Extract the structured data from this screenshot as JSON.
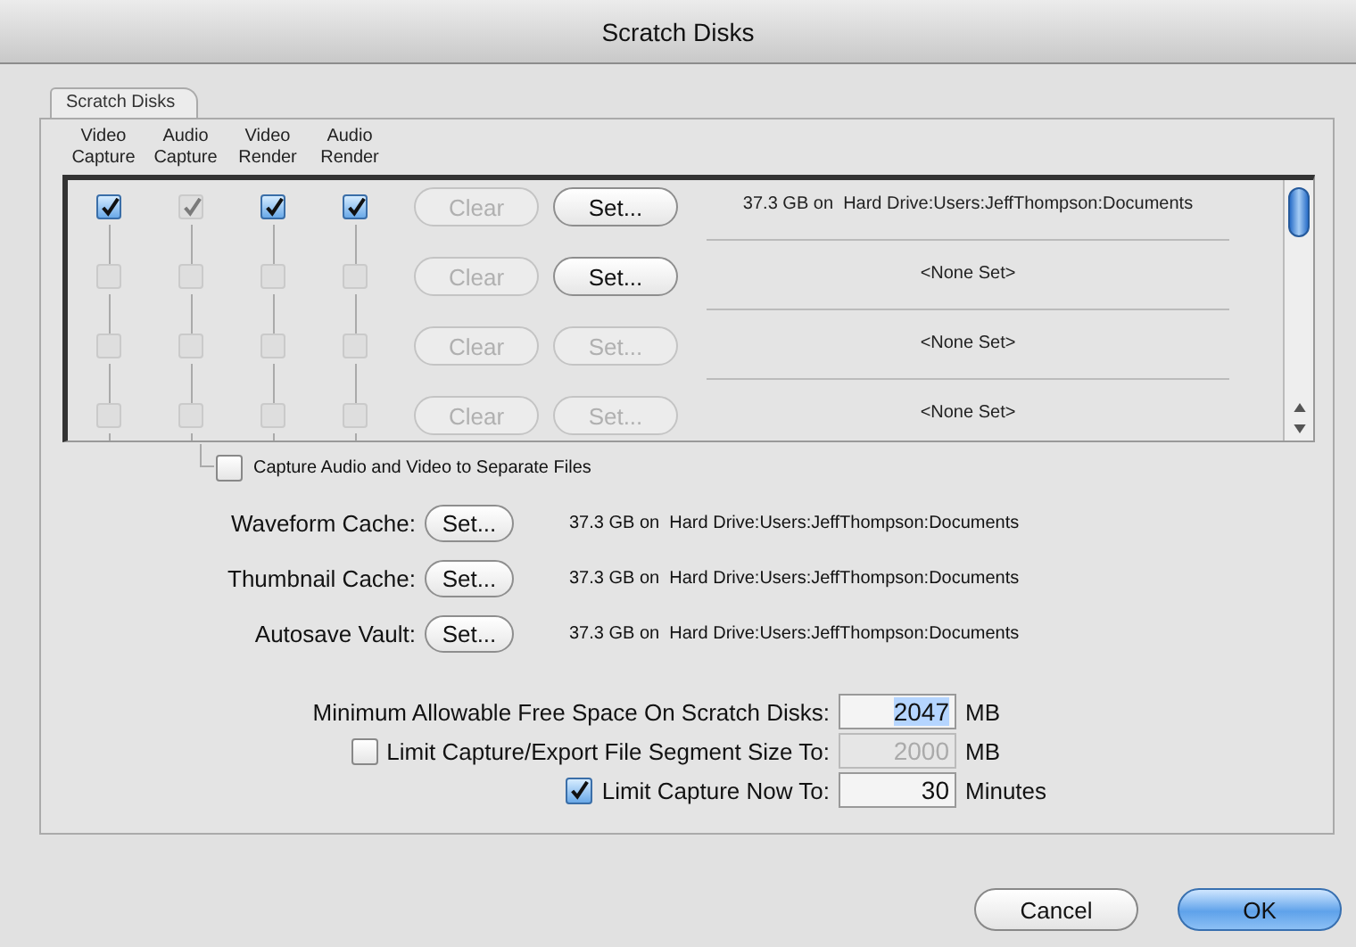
{
  "window": {
    "title": "Scratch Disks"
  },
  "tabs": [
    {
      "label": "Scratch Disks",
      "selected": true
    }
  ],
  "columns": [
    "Video Capture",
    "Audio Capture",
    "Video Render",
    "Audio Render"
  ],
  "disks": [
    {
      "checks": [
        {
          "checked": true,
          "disabled": false
        },
        {
          "checked": true,
          "disabled": true
        },
        {
          "checked": true,
          "disabled": false
        },
        {
          "checked": true,
          "disabled": false
        }
      ],
      "clear": {
        "label": "Clear",
        "disabled": true
      },
      "set": {
        "label": "Set...",
        "disabled": false
      },
      "location": "37.3 GB on  Hard Drive:Users:JeffThompson:Documents"
    },
    {
      "checks": [
        {
          "checked": false,
          "disabled": true
        },
        {
          "checked": false,
          "disabled": true
        },
        {
          "checked": false,
          "disabled": true
        },
        {
          "checked": false,
          "disabled": true
        }
      ],
      "clear": {
        "label": "Clear",
        "disabled": true
      },
      "set": {
        "label": "Set...",
        "disabled": false
      },
      "location": "<None Set>"
    },
    {
      "checks": [
        {
          "checked": false,
          "disabled": true
        },
        {
          "checked": false,
          "disabled": true
        },
        {
          "checked": false,
          "disabled": true
        },
        {
          "checked": false,
          "disabled": true
        }
      ],
      "clear": {
        "label": "Clear",
        "disabled": true
      },
      "set": {
        "label": "Set...",
        "disabled": true
      },
      "location": "<None Set>"
    },
    {
      "checks": [
        {
          "checked": false,
          "disabled": true
        },
        {
          "checked": false,
          "disabled": true
        },
        {
          "checked": false,
          "disabled": true
        },
        {
          "checked": false,
          "disabled": true
        }
      ],
      "clear": {
        "label": "Clear",
        "disabled": true
      },
      "set": {
        "label": "Set...",
        "disabled": true
      },
      "location": "<None Set>"
    }
  ],
  "separate_files": {
    "label": "Capture Audio and Video to Separate Files",
    "checked": false
  },
  "caches": [
    {
      "label": "Waveform Cache:",
      "button": "Set...",
      "location": "37.3 GB on  Hard Drive:Users:JeffThompson:Documents"
    },
    {
      "label": "Thumbnail Cache:",
      "button": "Set...",
      "location": "37.3 GB on  Hard Drive:Users:JeffThompson:Documents"
    },
    {
      "label": "Autosave Vault:",
      "button": "Set...",
      "location": "37.3 GB on  Hard Drive:Users:JeffThompson:Documents"
    }
  ],
  "limits": [
    {
      "kind": "plain",
      "label": "Minimum Allowable Free Space On Scratch Disks:",
      "value": "2047",
      "unit": "MB",
      "highlighted": true,
      "disabled": false
    },
    {
      "kind": "checkbox",
      "checked": false,
      "label": "Limit Capture/Export File Segment Size To:",
      "value": "2000",
      "unit": "MB",
      "highlighted": false,
      "disabled": true
    },
    {
      "kind": "checkbox",
      "checked": true,
      "label": "Limit Capture Now To:",
      "value": "30",
      "unit": "Minutes",
      "highlighted": false,
      "disabled": false
    }
  ],
  "buttons": [
    {
      "label": "Cancel",
      "default": false
    },
    {
      "label": "OK",
      "default": true
    }
  ]
}
